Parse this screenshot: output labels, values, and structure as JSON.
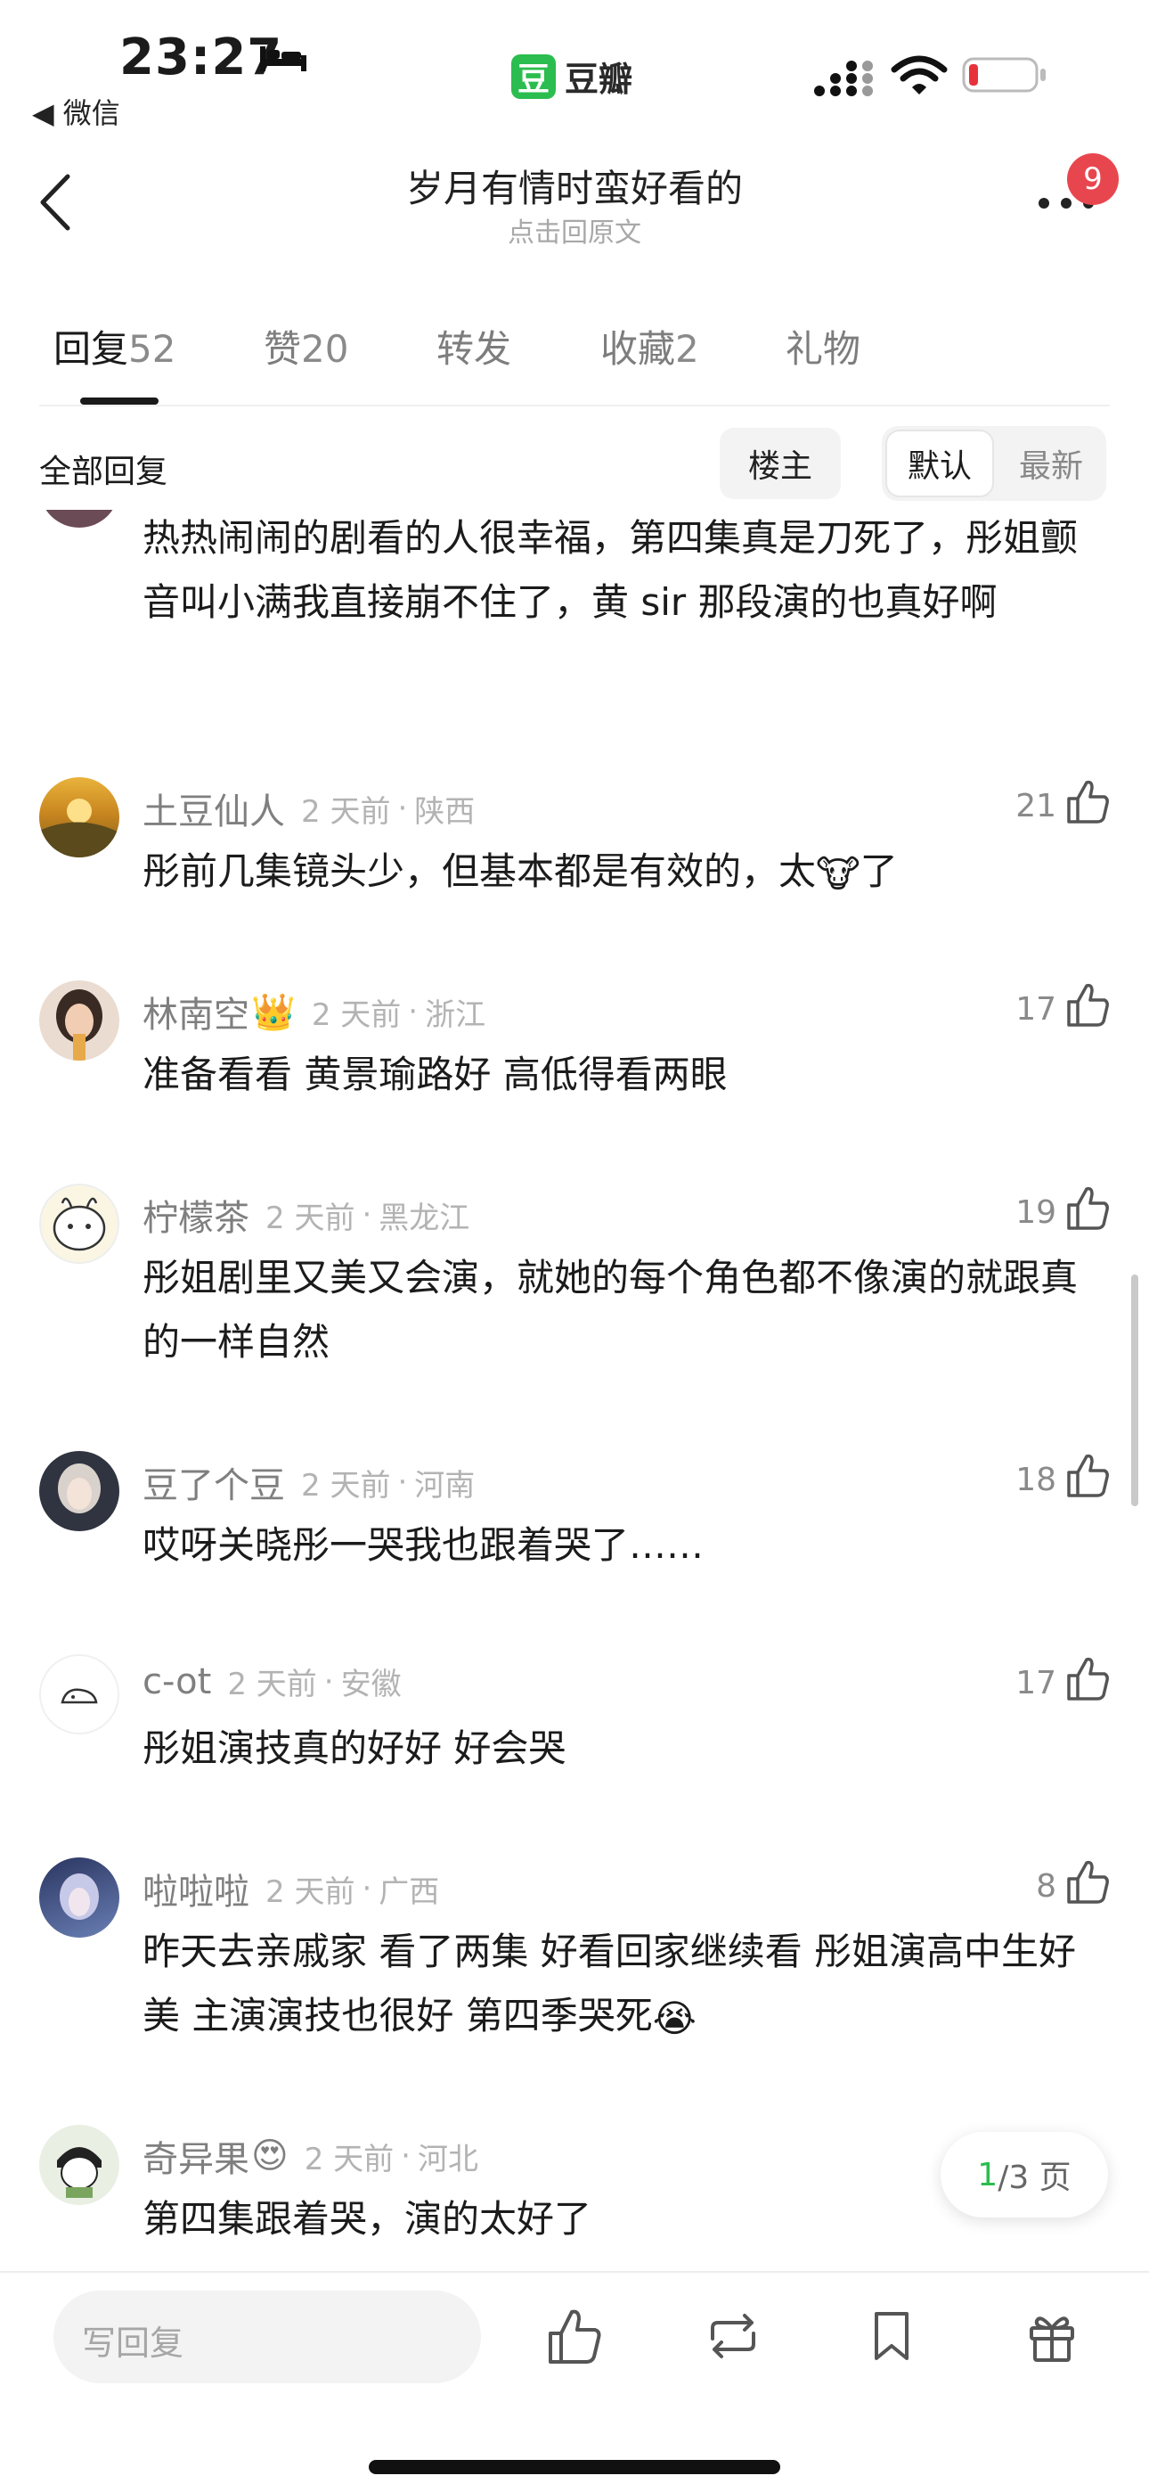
{
  "status_bar": {
    "time": "23:27",
    "back_app": "◀ 微信",
    "app_logo_char": "豆",
    "app_name": "豆瓣",
    "icons": [
      "sleep-bed-icon",
      "signal-icon",
      "wifi-icon",
      "battery-low-icon"
    ]
  },
  "nav": {
    "title": "岁月有情时蛮好看的",
    "subtitle": "点击回原文",
    "badge": "9"
  },
  "tabs": [
    {
      "label": "回复",
      "count": "52"
    },
    {
      "label": "赞",
      "count": "20"
    },
    {
      "label": "转发",
      "count": ""
    },
    {
      "label": "收藏",
      "count": "2"
    },
    {
      "label": "礼物",
      "count": ""
    }
  ],
  "filter": {
    "all": "全部回复",
    "owner": "楼主",
    "default": "默认",
    "newest": "最新"
  },
  "top_partial_comment": "热热闹闹的剧看的人很幸福，第四集真是刀死了，彤姐颤音叫小满我直接崩不住了，黄 sir 那段演的也真好啊",
  "comments": [
    {
      "name": "土豆仙人",
      "time": "2 天前",
      "location": "陕西",
      "likes": "21",
      "text_a": "彤前几集镜头少，但基本都是有效的，太",
      "text_b": "了",
      "emoji": "🐮"
    },
    {
      "name": "林南空",
      "time": "2 天前",
      "location": "浙江",
      "likes": "17",
      "text": "准备看看 黄景瑜路好 高低得看两眼",
      "name_emoji": "👑"
    },
    {
      "name": "柠檬茶",
      "time": "2 天前",
      "location": "黑龙江",
      "likes": "19",
      "text": "彤姐剧里又美又会演，就她的每个角色都不像演的就跟真的一样自然"
    },
    {
      "name": "豆了个豆",
      "time": "2 天前",
      "location": "河南",
      "likes": "18",
      "text": "哎呀关晓彤一哭我也跟着哭了……"
    },
    {
      "name": "c-ot",
      "time": "2 天前",
      "location": "安徽",
      "likes": "17",
      "text": "彤姐演技真的好好 好会哭"
    },
    {
      "name": "啦啦啦",
      "time": "2 天前",
      "location": "广西",
      "likes": "8",
      "text": "昨天去亲戚家 看了两集 好看回家继续看 彤姐演高中生好美 主演演技也很好 第四季哭死",
      "emoji": "😭"
    },
    {
      "name": "奇异果",
      "time": "2 天前",
      "location": "河北",
      "likes": "",
      "text": "第四集跟着哭，演的太好了",
      "name_emoji": "😍"
    }
  ],
  "pager": {
    "current": "1",
    "total": "/3 页"
  },
  "bottom_bar": {
    "reply_placeholder": "写回复",
    "icons": [
      "like-icon",
      "repost-icon",
      "bookmark-icon",
      "gift-icon"
    ]
  }
}
